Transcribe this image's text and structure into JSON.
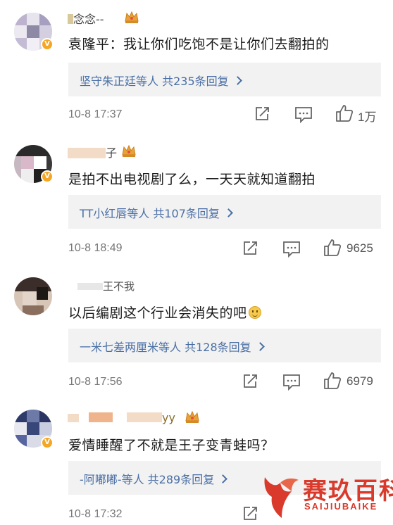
{
  "comments": [
    {
      "username": "念念--",
      "content": "袁隆平：我让你们吃饱不是让你们去翻拍的",
      "reply_names": "坚守朱正廷",
      "reply_suffix": "等人 共235条回复",
      "date": "10-8 17:37",
      "likes": "1万",
      "avatar_colors": [
        "#c9c0d8",
        "#8e8aa6",
        "#d8d3e3"
      ]
    },
    {
      "username": "子",
      "content": "是拍不出电视剧了么，一天天就知道翻拍",
      "reply_names": "TT小红唇",
      "reply_suffix": "等人 共107条回复",
      "date": "10-8 18:49",
      "likes": "9625",
      "avatar_colors": [
        "#2a2a2a",
        "#e9e9e9",
        "#c9b6c2"
      ]
    },
    {
      "username": "王不我",
      "content": "以后编剧这个行业会消失的吧",
      "reply_names": "一米七差两厘米",
      "reply_suffix": "等人 共128条回复",
      "date": "10-8 17:56",
      "likes": "6979",
      "avatar_colors": [
        "#3b2e2a",
        "#d7c6b8",
        "#8a6e5e"
      ]
    },
    {
      "username": "yy",
      "content": "爱情睡醒了不就是王子变青蛙吗？",
      "reply_names": "-阿嘟嘟-",
      "reply_suffix": "等人 共289条回复",
      "date": "10-8 17:32",
      "likes": "",
      "avatar_colors": [
        "#2e3b6a",
        "#d9dbe6",
        "#6d7aa8"
      ]
    }
  ],
  "watermark": {
    "cn": "赛玖百科",
    "en": "SAIJIUBAIKE"
  },
  "colors": {
    "link": "#4a6fa5",
    "reply_bg": "#f2f2f2",
    "watermark": "#d93a2b",
    "crown": "#e9a23b"
  }
}
